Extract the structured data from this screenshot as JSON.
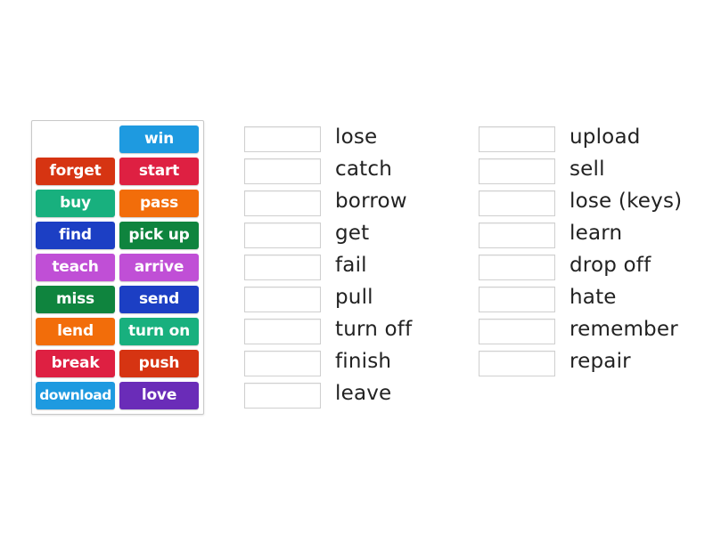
{
  "tiles": [
    {
      "label": "win",
      "color": "#1e9ae0"
    },
    {
      "label": "forget",
      "color": "#d63412"
    },
    {
      "label": "start",
      "color": "#de2042"
    },
    {
      "label": "buy",
      "color": "#18b07e"
    },
    {
      "label": "pass",
      "color": "#f26d0a"
    },
    {
      "label": "find",
      "color": "#1c3fc4"
    },
    {
      "label": "pick up",
      "color": "#0f843e"
    },
    {
      "label": "teach",
      "color": "#c04fd6"
    },
    {
      "label": "arrive",
      "color": "#c04fd6"
    },
    {
      "label": "miss",
      "color": "#0f843e"
    },
    {
      "label": "send",
      "color": "#1c3fc4"
    },
    {
      "label": "lend",
      "color": "#f26d0a"
    },
    {
      "label": "turn on",
      "color": "#18b07e"
    },
    {
      "label": "break",
      "color": "#de2042"
    },
    {
      "label": "push",
      "color": "#d63412"
    },
    {
      "label": "download",
      "color": "#1e9ae0"
    },
    {
      "label": "love",
      "color": "#6a2cb8"
    }
  ],
  "targets_left": [
    "lose",
    "catch",
    "borrow",
    "get",
    "fail",
    "pull",
    "turn off",
    "finish",
    "leave"
  ],
  "targets_right": [
    "upload",
    "sell",
    "lose (keys)",
    "learn",
    "drop off",
    "hate",
    "remember",
    "repair"
  ]
}
